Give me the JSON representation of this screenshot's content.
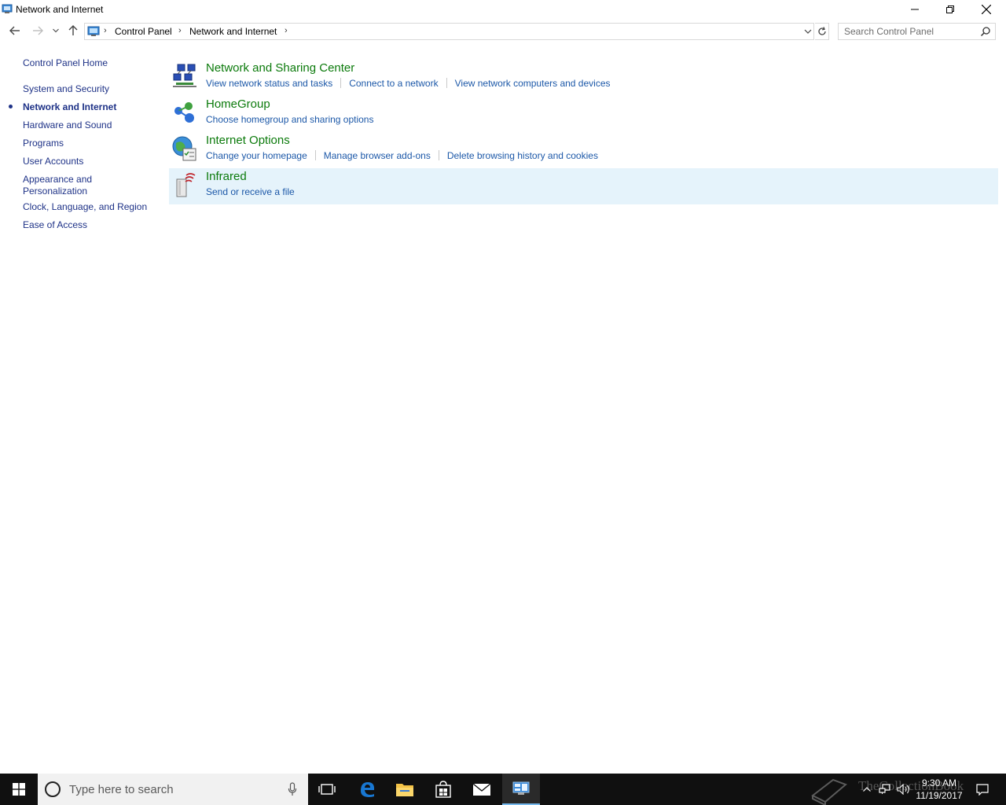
{
  "window": {
    "title": "Network and Internet"
  },
  "address": {
    "crumbs": [
      "Control Panel",
      "Network and Internet"
    ],
    "search_placeholder": "Search Control Panel"
  },
  "leftnav": {
    "items": [
      {
        "label": "Control Panel Home",
        "current": false
      },
      {
        "label": "System and Security",
        "current": false
      },
      {
        "label": "Network and Internet",
        "current": true
      },
      {
        "label": "Hardware and Sound",
        "current": false
      },
      {
        "label": "Programs",
        "current": false
      },
      {
        "label": "User Accounts",
        "current": false
      },
      {
        "label": "Appearance and Personalization",
        "current": false
      },
      {
        "label": "Clock, Language, and Region",
        "current": false
      },
      {
        "label": "Ease of Access",
        "current": false
      }
    ]
  },
  "categories": [
    {
      "title": "Network and Sharing Center",
      "icon": "network-sharing-icon",
      "links": [
        "View network status and tasks",
        "Connect to a network",
        "View network computers and devices"
      ]
    },
    {
      "title": "HomeGroup",
      "icon": "homegroup-icon",
      "links": [
        "Choose homegroup and sharing options"
      ]
    },
    {
      "title": "Internet Options",
      "icon": "internet-options-icon",
      "links": [
        "Change your homepage",
        "Manage browser add-ons",
        "Delete browsing history and cookies"
      ]
    },
    {
      "title": "Infrared",
      "icon": "infrared-icon",
      "links": [
        "Send or receive a file"
      ],
      "selected": true
    }
  ],
  "taskbar": {
    "search_placeholder": "Type here to search",
    "time": "9:30 AM",
    "date": "11/19/2017",
    "watermark": "TheCollectionBook"
  },
  "colors": {
    "category_title": "#0b7a0b",
    "link": "#1c58a8",
    "nav_link": "#1e3287",
    "selected_row": "#e5f3fb",
    "taskbar": "#101010"
  }
}
